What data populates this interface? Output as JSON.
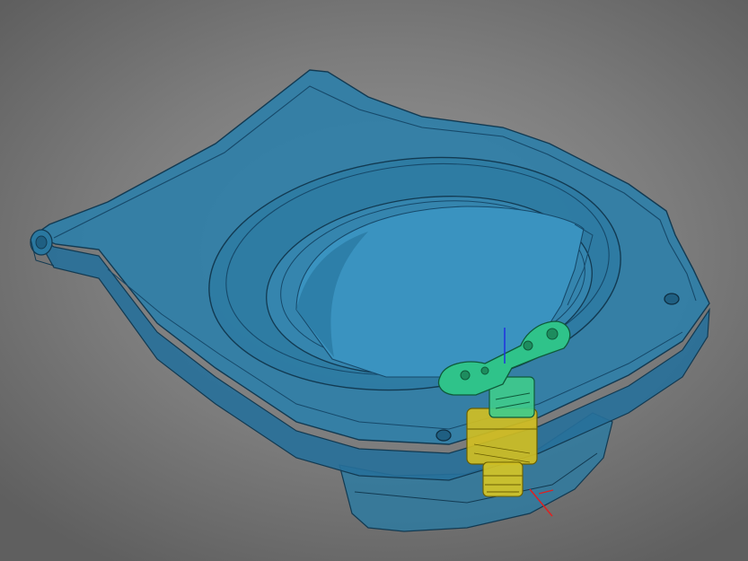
{
  "viewport": {
    "background_color": "#7d7d7d",
    "model": {
      "body_color": "#2f7fa8",
      "body_edge_color": "#123a52",
      "inner_bowl_color": "#3a93c0",
      "valve_handle_color": "#28c08c",
      "valve_body_color": "#d4c020",
      "axis_colors": {
        "x": "#e02020",
        "z": "#2030e0"
      }
    }
  }
}
